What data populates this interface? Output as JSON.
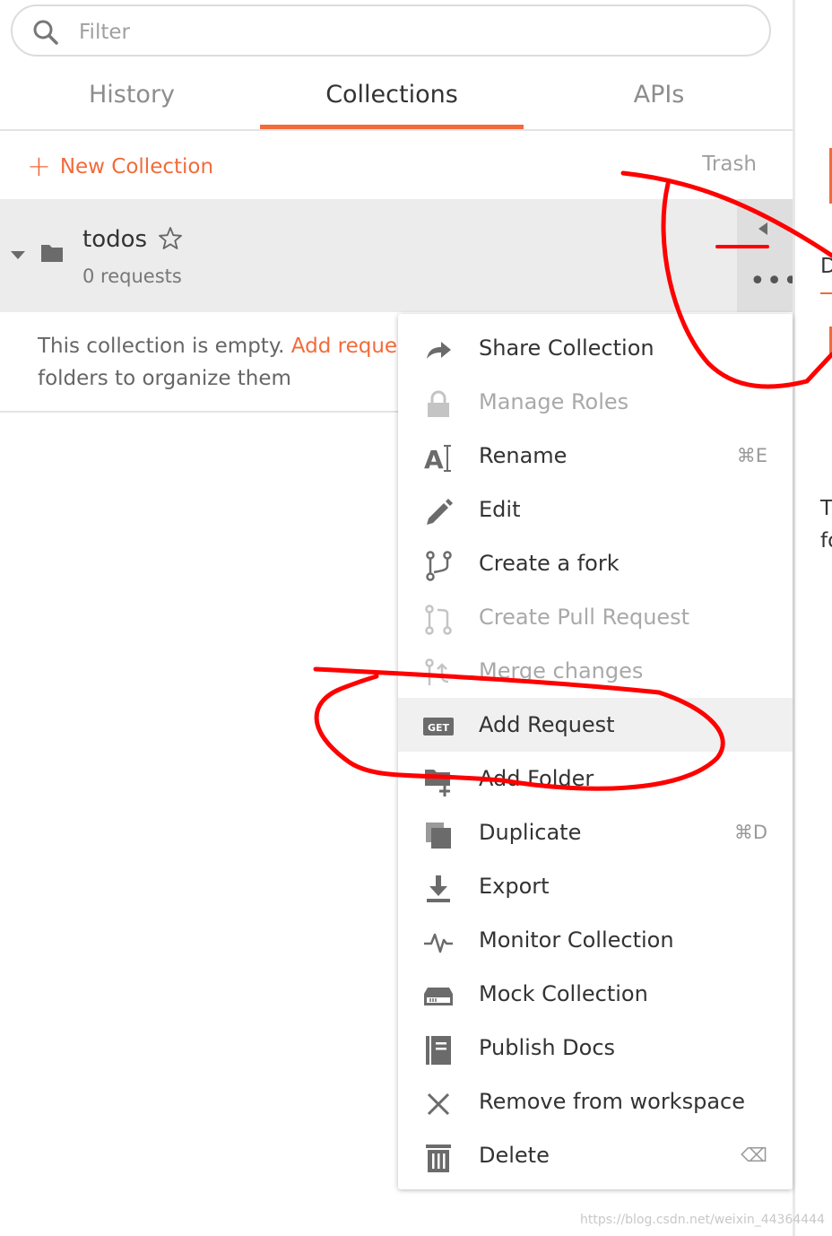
{
  "filter": {
    "placeholder": "Filter",
    "icon": "search-icon"
  },
  "tabs": [
    {
      "label": "History",
      "active": false
    },
    {
      "label": "Collections",
      "active": true
    },
    {
      "label": "APIs",
      "active": false
    }
  ],
  "actions": {
    "new_collection": "New Collection",
    "trash": "Trash"
  },
  "collection": {
    "name": "todos",
    "count": "0 requests"
  },
  "empty_state": {
    "text_before": "This collection is empty. ",
    "link": "Add reques",
    "line2": "folders to organize them"
  },
  "menu": {
    "items": [
      {
        "label": "Share Collection",
        "icon": "share-icon",
        "shortcut": "",
        "disabled": false
      },
      {
        "label": "Manage Roles",
        "icon": "lock-icon",
        "shortcut": "",
        "disabled": true
      },
      {
        "label": "Rename",
        "icon": "rename-icon",
        "shortcut": "⌘E",
        "disabled": false
      },
      {
        "label": "Edit",
        "icon": "pencil-icon",
        "shortcut": "",
        "disabled": false
      },
      {
        "label": "Create a fork",
        "icon": "fork-icon",
        "shortcut": "",
        "disabled": false
      },
      {
        "label": "Create Pull Request",
        "icon": "pull-request-icon",
        "shortcut": "",
        "disabled": true
      },
      {
        "label": "Merge changes",
        "icon": "merge-icon",
        "shortcut": "",
        "disabled": true
      },
      {
        "label": "Add Request",
        "icon": "get-request-icon",
        "shortcut": "",
        "disabled": false
      },
      {
        "label": "Add Folder",
        "icon": "add-folder-icon",
        "shortcut": "",
        "disabled": false
      },
      {
        "label": "Duplicate",
        "icon": "duplicate-icon",
        "shortcut": "⌘D",
        "disabled": false
      },
      {
        "label": "Export",
        "icon": "download-icon",
        "shortcut": "",
        "disabled": false
      },
      {
        "label": "Monitor Collection",
        "icon": "pulse-icon",
        "shortcut": "",
        "disabled": false
      },
      {
        "label": "Mock Collection",
        "icon": "server-icon",
        "shortcut": "",
        "disabled": false
      },
      {
        "label": "Publish Docs",
        "icon": "docs-icon",
        "shortcut": "",
        "disabled": false
      },
      {
        "label": "Remove from workspace",
        "icon": "close-icon",
        "shortcut": "",
        "disabled": false
      },
      {
        "label": "Delete",
        "icon": "trash-icon",
        "shortcut": "⌫",
        "disabled": false
      }
    ],
    "get_badge": "GET"
  },
  "right_edge": {
    "t1": "D",
    "t2": "T",
    "t3": "fo"
  },
  "watermark": "https://blog.csdn.net/weixin_44364444",
  "colors": {
    "accent": "#f26b3a",
    "annotation": "#ff0000"
  }
}
